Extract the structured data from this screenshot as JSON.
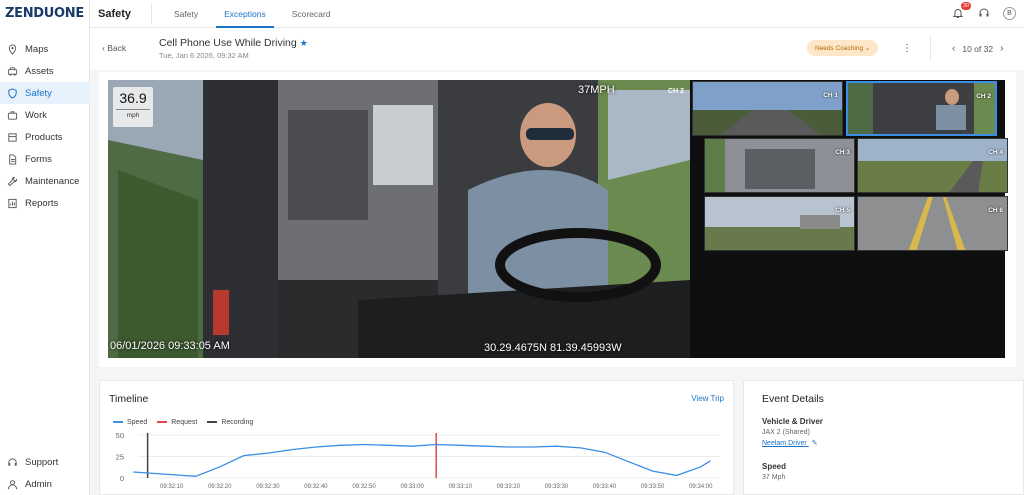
{
  "brand": {
    "logo": "ZENDUONE"
  },
  "sidebar": {
    "items": [
      {
        "label": "Maps",
        "icon": "map-pin-icon"
      },
      {
        "label": "Assets",
        "icon": "car-icon"
      },
      {
        "label": "Safety",
        "icon": "shield-icon",
        "active": true
      },
      {
        "label": "Work",
        "icon": "briefcase-icon"
      },
      {
        "label": "Products",
        "icon": "box-icon"
      },
      {
        "label": "Forms",
        "icon": "document-icon"
      },
      {
        "label": "Maintenance",
        "icon": "wrench-icon"
      },
      {
        "label": "Reports",
        "icon": "report-icon"
      }
    ],
    "bottom": [
      {
        "label": "Support",
        "icon": "headset-icon"
      },
      {
        "label": "Admin",
        "icon": "person-icon"
      }
    ]
  },
  "topbar": {
    "title": "Safety",
    "tabs": [
      {
        "label": "Safety",
        "active": false
      },
      {
        "label": "Exceptions",
        "active": true
      },
      {
        "label": "Scorecard",
        "active": false
      }
    ],
    "notification_count": "30",
    "avatar_initial": "B"
  },
  "event": {
    "back_label": "Back",
    "title": "Cell Phone Use While Driving",
    "date": "Tue, Jan 6 2026, 09:32 AM",
    "status": "Needs Coaching",
    "pager": "10 of 32"
  },
  "video": {
    "speed_value": "36.9",
    "speed_unit": "mph",
    "overlay_speed": "37MPH",
    "channel": "CH 2",
    "timestamp": "06/01/2026 09:33:05 AM",
    "gps": "30.29.4675N 81.39.45993W",
    "thumbnails": [
      "CH 1",
      "CH 2",
      "CH 3",
      "CH 4",
      "CH 5",
      "CH 6"
    ],
    "selected": "CH 2"
  },
  "timeline": {
    "title": "Timeline",
    "view_trip": "View Trip",
    "legend": [
      {
        "label": "Speed",
        "color": "#3a8ee6"
      },
      {
        "label": "Request",
        "color": "#e04848"
      },
      {
        "label": "Recording",
        "color": "#444444"
      }
    ]
  },
  "chart_data": {
    "type": "line",
    "title": "",
    "xlabel": "",
    "ylabel": "",
    "yticks": [
      0,
      25,
      50
    ],
    "ylim": [
      0,
      50
    ],
    "xticks": [
      "09:32:10",
      "09:32:20",
      "09:32:30",
      "09:32:40",
      "09:32:50",
      "09:33:00",
      "09:33:10",
      "09:33:20",
      "09:33:30",
      "09:33:40",
      "09:33:50",
      "09:34:00"
    ],
    "grid": true,
    "legend_position": "top-left",
    "series": [
      {
        "name": "Speed",
        "color": "#3a8ee6",
        "x": [
          "09:32:02",
          "09:32:10",
          "09:32:15",
          "09:32:20",
          "09:32:25",
          "09:32:30",
          "09:32:35",
          "09:32:40",
          "09:32:45",
          "09:32:50",
          "09:32:55",
          "09:33:00",
          "09:33:05",
          "09:33:10",
          "09:33:15",
          "09:33:20",
          "09:33:25",
          "09:33:30",
          "09:33:35",
          "09:33:40",
          "09:33:45",
          "09:33:50",
          "09:33:55",
          "09:34:00",
          "09:34:02"
        ],
        "values": [
          7,
          4,
          2,
          13,
          26,
          29,
          33,
          36,
          38,
          39,
          38,
          37,
          39,
          38,
          37,
          36,
          36,
          37,
          35,
          30,
          19,
          8,
          3,
          13,
          20
        ]
      }
    ],
    "markers": [
      {
        "name": "Recording",
        "x": "09:32:05",
        "color": "#444444"
      },
      {
        "name": "Request",
        "x": "09:33:05",
        "color": "#e04848"
      }
    ]
  },
  "details": {
    "title": "Event Details",
    "vehicle_label": "Vehicle & Driver",
    "vehicle": "JAX 2 (Shared)",
    "driver": "Neelam Driver",
    "speed_label": "Speed",
    "speed": "37 Mph"
  }
}
